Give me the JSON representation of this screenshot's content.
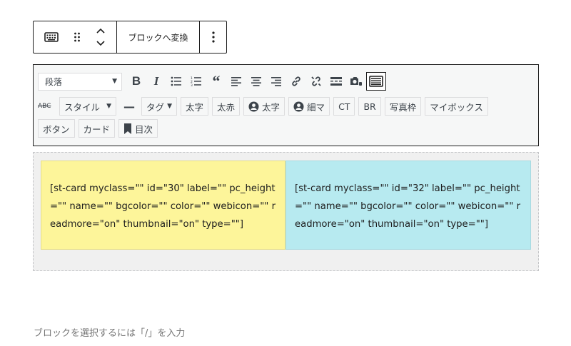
{
  "block_toolbar": {
    "icons": [
      "keyboard-icon",
      "drag-handle-icon",
      "move-up-down-icon"
    ],
    "convert_label": "ブロックへ変換",
    "more_icon": "vertical-ellipsis-icon"
  },
  "editor_toolbar": {
    "format_select": "段落",
    "row1_icons": [
      "bold-icon",
      "italic-icon",
      "bullet-list-icon",
      "numbered-list-icon",
      "blockquote-icon",
      "align-left-icon",
      "align-center-icon",
      "align-right-icon",
      "link-icon",
      "unlink-icon",
      "read-more-icon",
      "camera-icon",
      "keyboard-toggle-icon"
    ],
    "row2": {
      "abc_label": "ABC",
      "style_label": "スタイル",
      "dash_label": "—",
      "tag_label": "タグ",
      "buttons": [
        "太字",
        "太赤"
      ],
      "user_bold_label": "太字",
      "user_thin_label": "細マ",
      "ct_label": "CT",
      "br_label": "BR",
      "photo_frame_label": "写真枠",
      "mybox_label": "マイボックス"
    },
    "row3": {
      "button_label": "ボタン",
      "card_label": "カード",
      "toc_label": "目次"
    }
  },
  "content": {
    "cards": [
      {
        "text": "[st-card myclass=\"\" id=\"30\" label=\"\" pc_height=\"\" name=\"\" bgcolor=\"\" color=\"\" webicon=\"\" readmore=\"on\" thumbnail=\"on\" type=\"\"]",
        "color": "#fdf59a"
      },
      {
        "text": "[st-card myclass=\"\" id=\"32\" label=\"\" pc_height=\"\" name=\"\" bgcolor=\"\" color=\"\" webicon=\"\" readmore=\"on\" thumbnail=\"on\" type=\"\"]",
        "color": "#b7eaf0"
      }
    ]
  },
  "placeholder": "ブロックを選択するには「/」を入力"
}
